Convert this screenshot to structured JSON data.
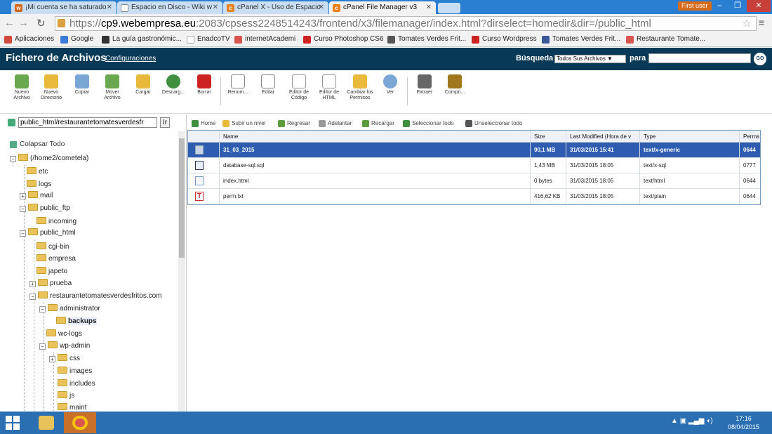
{
  "browser": {
    "tabs": [
      {
        "title": "¡Mi cuenta se ha saturado",
        "icon": "mail-icon",
        "color": "#d46416"
      },
      {
        "title": "Espacio en Disco - Wiki w",
        "icon": "page-icon",
        "color": "#888888"
      },
      {
        "title": "cPanel X - Uso de Espacio",
        "icon": "cpanel-icon",
        "color": "#e8821f"
      },
      {
        "title": "cPanel File Manager v3",
        "icon": "cpanel-icon",
        "color": "#e8821f"
      }
    ],
    "user_badge": "First user",
    "url_prefix": "https://",
    "url_host": "cp9.webempresa.eu",
    "url_rest": ":2083/cpsess2248514243/frontend/x3/filemanager/index.html?dirselect=homedir&dir=/public_html",
    "bookmarks": [
      {
        "label": "Aplicaciones",
        "color": "#d04b3a"
      },
      {
        "label": "Google",
        "color": "#3b7ad8"
      },
      {
        "label": "La guía gastronómic...",
        "color": "#333333"
      },
      {
        "label": "EnadcoTV",
        "color": "#cccccc"
      },
      {
        "label": "internetAcademi",
        "color": "#d9534f"
      },
      {
        "label": "Curso Photoshop CS6",
        "color": "#cc2222"
      },
      {
        "label": "Tomates Verdes Frit...",
        "color": "#555555"
      },
      {
        "label": "Curso Wordpress",
        "color": "#cc2222"
      },
      {
        "label": "Tomates Verdes Frit...",
        "color": "#3b5998"
      },
      {
        "label": "Restaurante Tomate...",
        "color": "#d9534f"
      }
    ]
  },
  "header": {
    "title": "Fichero de Archivos",
    "config_link": "Configuraciones",
    "search_label": "Búsqueda",
    "search_scope": "Todos Sus Archivos ▼",
    "search_para": "para",
    "go_label": "GO"
  },
  "toolbar": [
    {
      "label": "Nuevo Archivo",
      "icon": "new-file-icon",
      "color": "#6aa84f"
    },
    {
      "label": "Nuevo Directorio",
      "icon": "new-folder-icon",
      "color": "#e9b93c"
    },
    {
      "label": "Copiar",
      "icon": "copy-icon",
      "color": "#7aa6d6"
    },
    {
      "label": "Mover Archivo",
      "icon": "move-icon",
      "color": "#6aa84f"
    },
    {
      "label": "Cargar",
      "icon": "upload-icon",
      "color": "#e9b93c"
    },
    {
      "label": "Descarg...",
      "icon": "download-icon",
      "color": "#3f8f3f"
    },
    {
      "label": "Borrar",
      "icon": "delete-icon",
      "color": "#cc2222"
    },
    {
      "label": "Renom...",
      "icon": "rename-icon",
      "color": "#888888"
    },
    {
      "label": "Editar",
      "icon": "edit-icon",
      "color": "#888888"
    },
    {
      "label": "Editor de Código",
      "icon": "code-editor-icon",
      "color": "#999999"
    },
    {
      "label": "Editor de HTML",
      "icon": "html-editor-icon",
      "color": "#999999"
    },
    {
      "label": "Cambiar los Permisos",
      "icon": "permissions-icon",
      "color": "#e9b93c"
    },
    {
      "label": "Ver",
      "icon": "view-icon",
      "color": "#7aa6d6"
    },
    {
      "label": "Extraer",
      "icon": "extract-icon",
      "color": "#666666"
    },
    {
      "label": "Compri...",
      "icon": "compress-icon",
      "color": "#a0781e"
    }
  ],
  "left": {
    "path": "public_html/restaurantetomatesverdesfr",
    "go": "Ir",
    "collapse": "Colapsar Todo",
    "tree": [
      {
        "label": "(/home2/cometela)",
        "toggle": "−"
      },
      {
        "label": "etc",
        "toggle": ""
      },
      {
        "label": "logs",
        "toggle": ""
      },
      {
        "label": "mail",
        "toggle": "+"
      },
      {
        "label": "public_ftp",
        "toggle": "−"
      },
      {
        "label": "incoming",
        "toggle": ""
      },
      {
        "label": "public_html",
        "toggle": "−"
      },
      {
        "label": "cgi-bin",
        "toggle": ""
      },
      {
        "label": "empresa",
        "toggle": ""
      },
      {
        "label": "japeto",
        "toggle": ""
      },
      {
        "label": "prueba",
        "toggle": "+"
      },
      {
        "label": "restaurantetomatesverdesfritos.com",
        "toggle": "−"
      },
      {
        "label": "administrator",
        "toggle": "−"
      },
      {
        "label": "backups",
        "toggle": ""
      },
      {
        "label": "wc-logs",
        "toggle": ""
      },
      {
        "label": "wp-admin",
        "toggle": "−"
      },
      {
        "label": "css",
        "toggle": "+"
      },
      {
        "label": "images",
        "toggle": ""
      },
      {
        "label": "includes",
        "toggle": ""
      },
      {
        "label": "js",
        "toggle": ""
      },
      {
        "label": "maint",
        "toggle": ""
      }
    ]
  },
  "right": {
    "nav": [
      {
        "label": "Home",
        "color": "#3f8f3f"
      },
      {
        "label": "Subir un nivel",
        "color": "#e9b93c"
      },
      {
        "label": "Regresar",
        "color": "#5a9b3a"
      },
      {
        "label": "Adelantar",
        "color": "#999999"
      },
      {
        "label": "Recargar",
        "color": "#5a9b3a"
      },
      {
        "label": "Seleccionar todo",
        "color": "#3f8f3f"
      },
      {
        "label": "Unseleccionar todo",
        "color": "#555555"
      }
    ],
    "columns": [
      "Name",
      "Size",
      "Last Modified (Hora de v",
      "Type",
      "Perms"
    ],
    "files": [
      {
        "name": "31_03_2015",
        "size": "90,1 MB",
        "modified": "31/03/2015 15:41",
        "type": "text/x-generic",
        "perms": "0644",
        "icon": "generic-file-icon"
      },
      {
        "name": "database-sql.sql",
        "size": "1,43 MB",
        "modified": "31/03/2015 18:05",
        "type": "text/x-sql",
        "perms": "0777",
        "icon": "sql-file-icon"
      },
      {
        "name": "index.html",
        "size": "0 bytes",
        "modified": "31/03/2015 18:05",
        "type": "text/html",
        "perms": "0644",
        "icon": "html-file-icon"
      },
      {
        "name": "perm.txt",
        "size": "416,62 KB",
        "modified": "31/03/2015 18:05",
        "type": "text/plain",
        "perms": "0644",
        "icon": "text-file-icon"
      }
    ]
  },
  "taskbar": {
    "time": "17:16",
    "date": "08/04/2015"
  }
}
